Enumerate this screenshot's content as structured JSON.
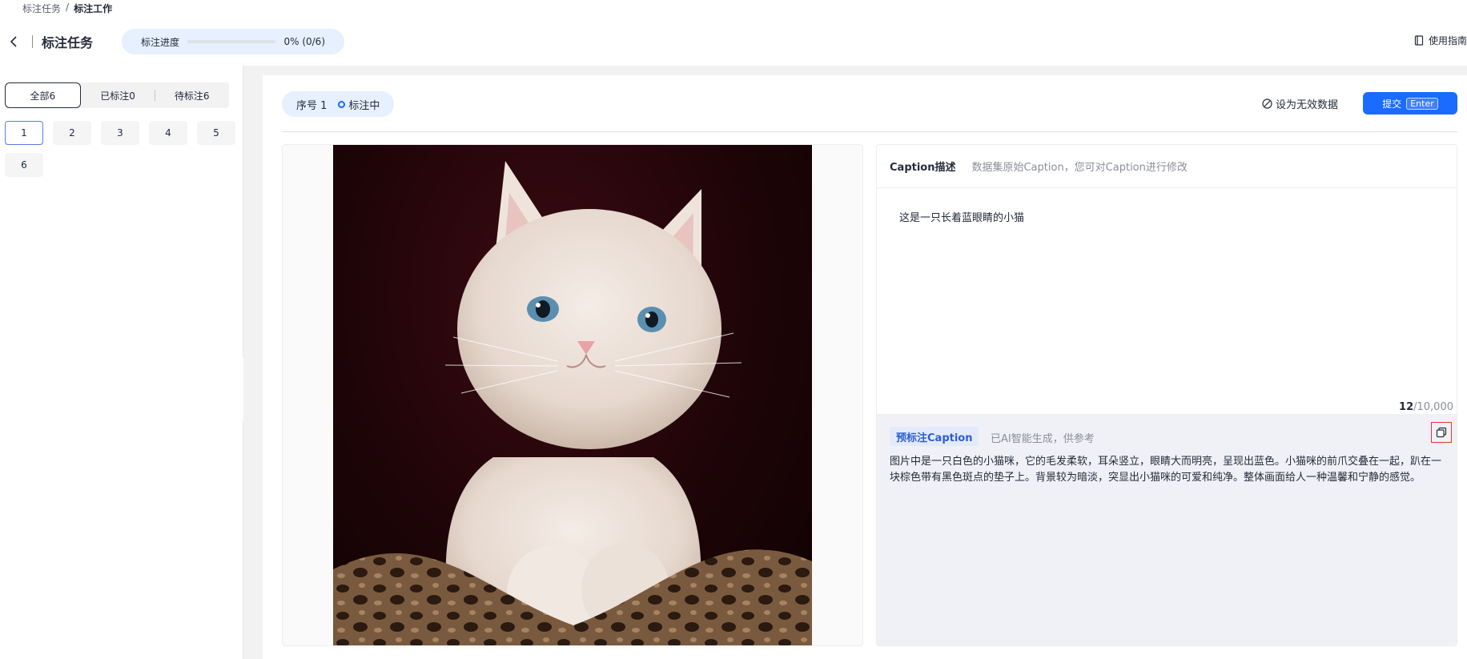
{
  "breadcrumb": {
    "parent": "标注任务",
    "sep": "/",
    "current": "标注工作"
  },
  "header": {
    "title": "标注任务",
    "progress_label": "标注进度",
    "progress_fraction": 0.0,
    "progress_text": "0% (0/6)",
    "guide_label": "使用指南"
  },
  "filters": {
    "all": "全部6",
    "done": "已标注0",
    "pending": "待标注6"
  },
  "items": [
    "1",
    "2",
    "3",
    "4",
    "5",
    "6"
  ],
  "task": {
    "seq_label": "序号 1",
    "status": "标注中",
    "invalid_label": "设为无效数据",
    "submit_label": "提交",
    "submit_key": "Enter"
  },
  "caption": {
    "title": "Caption描述",
    "subtitle": "数据集原始Caption，您可对Caption进行修改",
    "text": "这是一只长着蓝眼睛的小猫",
    "count": "12",
    "max": "/10,000"
  },
  "pre_caption": {
    "badge": "预标注Caption",
    "note": "已AI智能生成，供参考",
    "text": "图片中是一只白色的小猫咪，它的毛发柔软，耳朵竖立，眼睛大而明亮，呈现出蓝色。小猫咪的前爪交叠在一起，趴在一块棕色带有黑色斑点的垫子上。背景较为暗淡，突显出小猫咪的可爱和纯净。整体画面给人一种温馨和宁静的感觉。"
  },
  "colors": {
    "accent": "#1a6bff",
    "pill": "#e6f0fe",
    "highlight": "#e03636"
  }
}
